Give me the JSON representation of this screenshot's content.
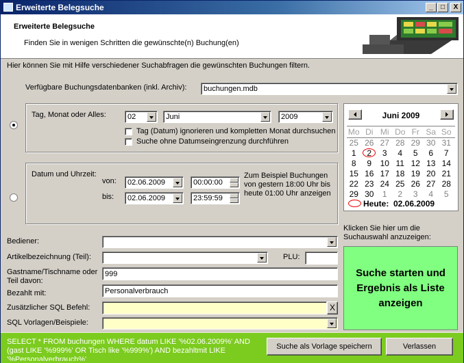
{
  "window": {
    "title": "Erweiterte Belegsuche",
    "controls": [
      "_",
      "□",
      "X"
    ]
  },
  "header": {
    "title": "Erweiterte Belegsuche",
    "subtitle": "Finden Sie in wenigen Schritten die gewünschte(n) Buchung(en)"
  },
  "intro": "Hier können Sie mit Hilfe verschiedener Suchabfragen die gewünschten Buchungen filtern.",
  "database": {
    "label": "Verfügbare Buchungsdatenbanken (inkl. Archiv):",
    "value": "buchungen.mdb"
  },
  "day_group": {
    "label": "Tag, Monat oder Alles:",
    "day": "02",
    "month": "Juni",
    "year": "2009",
    "check1": "Tag (Datum) ignorieren und kompletten Monat durchsuchen",
    "check2": "Suche ohne Datumseingrenzung durchführen"
  },
  "time_group": {
    "label": "Datum und Uhrzeit:",
    "from_label": "von:",
    "to_label": "bis:",
    "from_date": "02.06.2009",
    "from_time": "00:00:00",
    "to_date": "02.06.2009",
    "to_time": "23:59:59",
    "hint": [
      "Zum Beispiel Buchungen",
      "von gestern 18:00 Uhr bis",
      "heute 01:00 Uhr anzeigen"
    ]
  },
  "calendar": {
    "title": "Juni 2009",
    "weekdays": [
      "Mo",
      "Di",
      "Mi",
      "Do",
      "Fr",
      "Sa",
      "So"
    ],
    "weeks": [
      [
        "25",
        "26",
        "27",
        "28",
        "29",
        "30",
        "31"
      ],
      [
        "1",
        "2",
        "3",
        "4",
        "5",
        "6",
        "7"
      ],
      [
        "8",
        "9",
        "10",
        "11",
        "12",
        "13",
        "14"
      ],
      [
        "15",
        "16",
        "17",
        "18",
        "19",
        "20",
        "21"
      ],
      [
        "22",
        "23",
        "24",
        "25",
        "26",
        "27",
        "28"
      ],
      [
        "29",
        "30",
        "1",
        "2",
        "3",
        "4",
        "5"
      ]
    ],
    "today_label": "Heute:",
    "today_value": "02.06.2009"
  },
  "fields": {
    "bediener_label": "Bediener:",
    "artikel_label": "Artikelbezeichnung (Teil):",
    "plu_label": "PLU:",
    "gast_label": "Gastname/Tischname oder Teil davon:",
    "gast_value": "999",
    "bezahlt_label": "Bezahlt mit:",
    "bezahlt_value": "Personalverbrauch",
    "sql_label": "Zusätzlicher SQL Befehl:",
    "sql_clear": "X",
    "vorlagen_label": "SQL Vorlagen/Beispiele:"
  },
  "search_panel": {
    "hint": "Klicken Sie hier um die Suchauswahl anzuzeigen:",
    "button": "Suche starten und Ergebnis als Liste anzeigen"
  },
  "footer": {
    "sql": "SELECT * FROM buchungen WHERE datum LIKE '%02.06.2009%' AND (gast LIKE '%999%' OR Tisch like '%999%') AND bezahltmit LIKE '%Personalverbrauch%'",
    "save_button": "Suche als Vorlage speichern",
    "leave_button": "Verlassen"
  }
}
